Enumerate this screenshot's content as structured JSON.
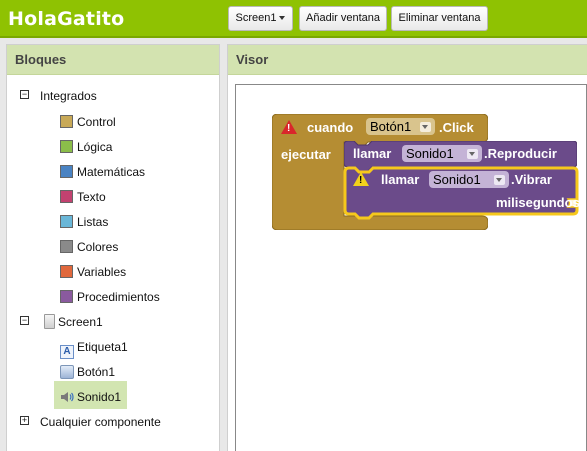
{
  "app": {
    "title": "HolaGatito"
  },
  "toolbar": {
    "screen_label": "Screen1",
    "add_screen_label": "Añadir ventana",
    "remove_screen_label": "Eliminar ventana"
  },
  "blocks_panel": {
    "title": "Bloques",
    "builtin": {
      "label": "Integrados",
      "items": [
        {
          "label": "Control",
          "color": "#c8a957"
        },
        {
          "label": "Lógica",
          "color": "#8bbd4a"
        },
        {
          "label": "Matemáticas",
          "color": "#4a83c3"
        },
        {
          "label": "Texto",
          "color": "#c24270"
        },
        {
          "label": "Listas",
          "color": "#6ab7d8"
        },
        {
          "label": "Colores",
          "color": "#8a8a8a"
        },
        {
          "label": "Variables",
          "color": "#e0683c"
        },
        {
          "label": "Procedimientos",
          "color": "#8a5a9e"
        }
      ]
    },
    "screen": {
      "label": "Screen1",
      "components": [
        {
          "label": "Etiqueta1",
          "icon": "label-icon"
        },
        {
          "label": "Botón1",
          "icon": "button-icon"
        },
        {
          "label": "Sonido1",
          "icon": "sound-icon",
          "selected": true
        }
      ]
    },
    "any_component": {
      "label": "Cualquier componente"
    }
  },
  "viewer": {
    "title": "Visor",
    "event_block": {
      "keyword": "cuando",
      "component": "Botón1",
      "event": ".Click",
      "do_label": "ejecutar",
      "color": "#b58d33"
    },
    "call_block_1": {
      "keyword": "llamar",
      "component": "Sonido1",
      "method": ".Reproducir",
      "color": "#6b4b8a"
    },
    "call_block_2": {
      "keyword": "llamar",
      "component": "Sonido1",
      "method": ".Vibrar",
      "param": "milisegundos",
      "color": "#6b4b8a"
    }
  }
}
